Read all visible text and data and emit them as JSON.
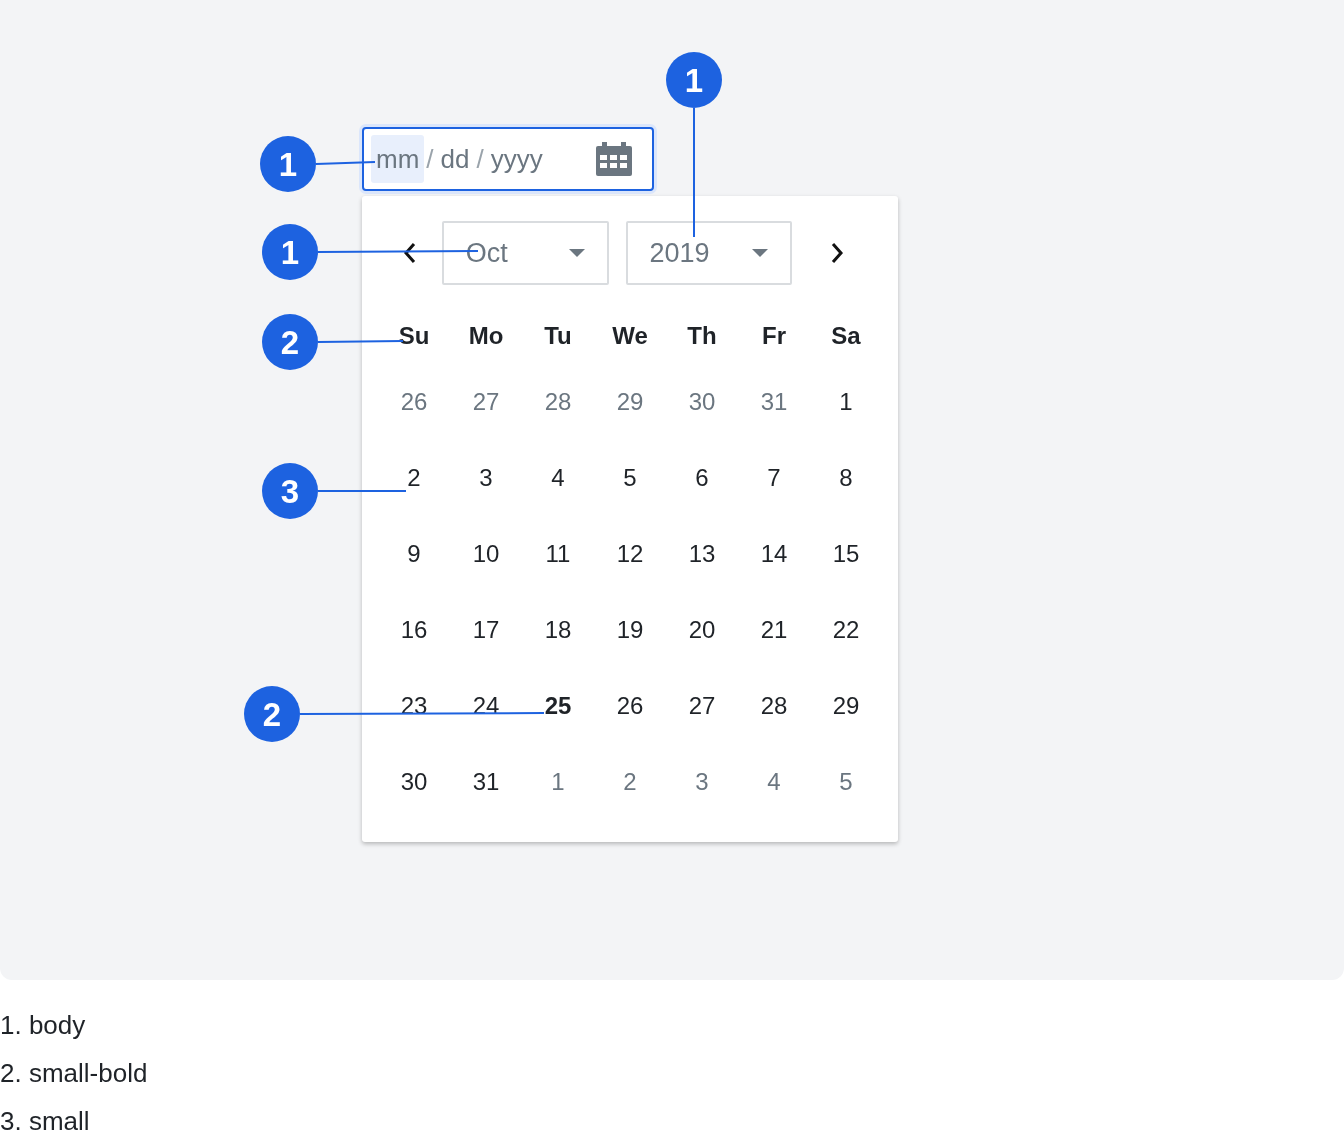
{
  "date_field": {
    "segments": [
      {
        "text": "mm",
        "selected": true
      },
      {
        "text": "dd",
        "selected": false
      },
      {
        "text": "yyyy",
        "selected": false
      }
    ],
    "separators": [
      "/",
      "/"
    ]
  },
  "calendar": {
    "month": "Oct",
    "year": "2019",
    "weekdays": [
      "Su",
      "Mo",
      "Tu",
      "We",
      "Th",
      "Fr",
      "Sa"
    ],
    "weeks": [
      [
        {
          "day": "26",
          "muted": true,
          "selected": false
        },
        {
          "day": "27",
          "muted": true,
          "selected": false
        },
        {
          "day": "28",
          "muted": true,
          "selected": false
        },
        {
          "day": "29",
          "muted": true,
          "selected": false
        },
        {
          "day": "30",
          "muted": true,
          "selected": false
        },
        {
          "day": "31",
          "muted": true,
          "selected": false
        },
        {
          "day": "1",
          "muted": false,
          "selected": false
        }
      ],
      [
        {
          "day": "2",
          "muted": false,
          "selected": false
        },
        {
          "day": "3",
          "muted": false,
          "selected": false
        },
        {
          "day": "4",
          "muted": false,
          "selected": false
        },
        {
          "day": "5",
          "muted": false,
          "selected": false
        },
        {
          "day": "6",
          "muted": false,
          "selected": false
        },
        {
          "day": "7",
          "muted": false,
          "selected": false
        },
        {
          "day": "8",
          "muted": false,
          "selected": false
        }
      ],
      [
        {
          "day": "9",
          "muted": false,
          "selected": false
        },
        {
          "day": "10",
          "muted": false,
          "selected": false
        },
        {
          "day": "11",
          "muted": false,
          "selected": false
        },
        {
          "day": "12",
          "muted": false,
          "selected": false
        },
        {
          "day": "13",
          "muted": false,
          "selected": false
        },
        {
          "day": "14",
          "muted": false,
          "selected": false
        },
        {
          "day": "15",
          "muted": false,
          "selected": false
        }
      ],
      [
        {
          "day": "16",
          "muted": false,
          "selected": false
        },
        {
          "day": "17",
          "muted": false,
          "selected": false
        },
        {
          "day": "18",
          "muted": false,
          "selected": false
        },
        {
          "day": "19",
          "muted": false,
          "selected": false
        },
        {
          "day": "20",
          "muted": false,
          "selected": false
        },
        {
          "day": "21",
          "muted": false,
          "selected": false
        },
        {
          "day": "22",
          "muted": false,
          "selected": false
        }
      ],
      [
        {
          "day": "23",
          "muted": false,
          "selected": false
        },
        {
          "day": "24",
          "muted": false,
          "selected": false
        },
        {
          "day": "25",
          "muted": false,
          "selected": true
        },
        {
          "day": "26",
          "muted": false,
          "selected": false
        },
        {
          "day": "27",
          "muted": false,
          "selected": false
        },
        {
          "day": "28",
          "muted": false,
          "selected": false
        },
        {
          "day": "29",
          "muted": false,
          "selected": false
        }
      ],
      [
        {
          "day": "30",
          "muted": false,
          "selected": false
        },
        {
          "day": "31",
          "muted": false,
          "selected": false
        },
        {
          "day": "1",
          "muted": true,
          "selected": false
        },
        {
          "day": "2",
          "muted": true,
          "selected": false
        },
        {
          "day": "3",
          "muted": true,
          "selected": false
        },
        {
          "day": "4",
          "muted": true,
          "selected": false
        },
        {
          "day": "5",
          "muted": true,
          "selected": false
        }
      ]
    ]
  },
  "annotations": [
    "1",
    "1",
    "1",
    "2",
    "3",
    "2"
  ],
  "legend": [
    "1. body",
    "2. small-bold",
    "3. small"
  ]
}
